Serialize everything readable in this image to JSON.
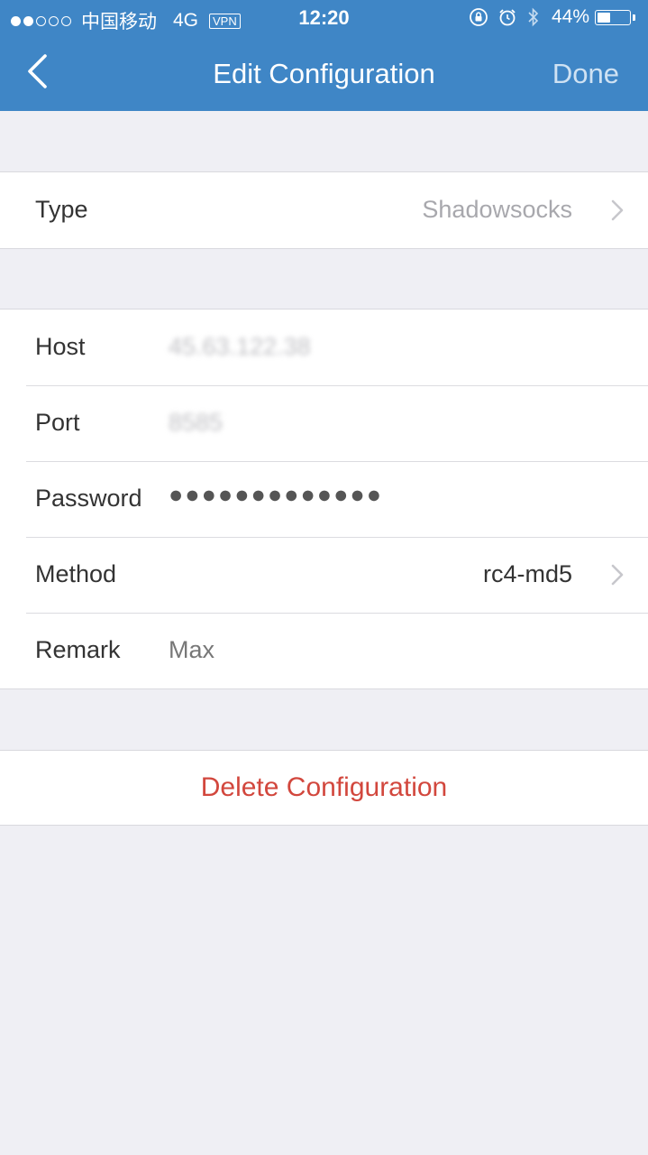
{
  "status_bar": {
    "carrier": "中国移动",
    "network": "4G",
    "vpn": "VPN",
    "time": "12:20",
    "battery": "44%",
    "battery_level": 0.44
  },
  "nav": {
    "title": "Edit Configuration",
    "done_label": "Done"
  },
  "type_row": {
    "label": "Type",
    "value": "Shadowsocks"
  },
  "fields": {
    "host": {
      "label": "Host",
      "value": "45.63.122.38"
    },
    "port": {
      "label": "Port",
      "value": "8585"
    },
    "password": {
      "label": "Password",
      "value": "●●●●●●●●●●●●●"
    },
    "method": {
      "label": "Method",
      "value": "rc4-md5"
    },
    "remark": {
      "label": "Remark",
      "value": "Max"
    }
  },
  "delete_label": "Delete Configuration",
  "colors": {
    "nav_bar": "#3f86c6",
    "background": "#efeff4",
    "destructive": "#d2473d"
  }
}
